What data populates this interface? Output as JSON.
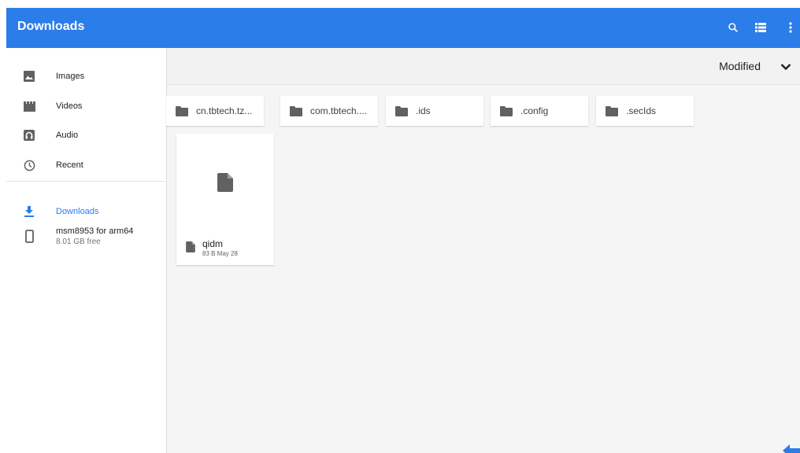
{
  "appbar": {
    "title": "Downloads",
    "actions": [
      {
        "name": "search",
        "icon": "search-icon"
      },
      {
        "name": "list-view",
        "icon": "list-view-icon"
      },
      {
        "name": "more",
        "icon": "more-vert-icon"
      }
    ],
    "color": "#2b7de9"
  },
  "sidebar": {
    "roots": [
      {
        "label": "Images",
        "icon": "image-icon"
      },
      {
        "label": "Videos",
        "icon": "video-icon"
      },
      {
        "label": "Audio",
        "icon": "audio-icon"
      },
      {
        "label": "Recent",
        "icon": "clock-icon"
      }
    ],
    "locations": [
      {
        "label": "Downloads",
        "icon": "download-icon",
        "active": true
      }
    ],
    "device": {
      "label": "msm8953 for arm64",
      "sub": "8.01 GB free",
      "icon": "phone-icon"
    }
  },
  "sort": {
    "label": "Modified",
    "icon": "chevron-down-icon"
  },
  "folders": [
    {
      "name": "cn.tbtech.tz..."
    },
    {
      "name": "com.tbtech...."
    },
    {
      "name": ".ids"
    },
    {
      "name": ".config"
    },
    {
      "name": ".secIds"
    }
  ],
  "files": [
    {
      "name": "qidm",
      "meta": "83 B May 28"
    }
  ],
  "colors": {
    "accent": "#2b7de9",
    "icon_grey": "#616161"
  }
}
